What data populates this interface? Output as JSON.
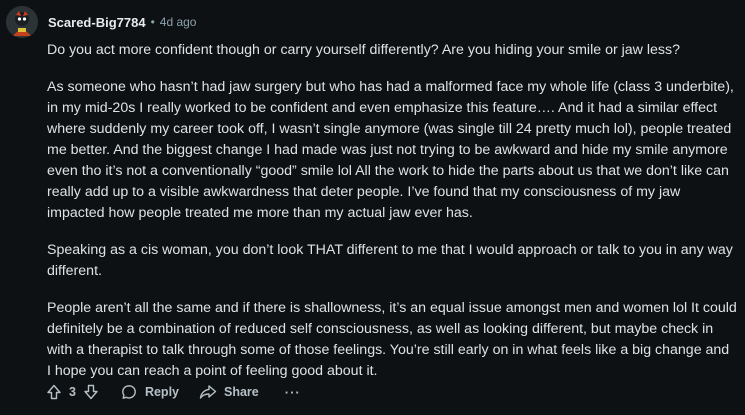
{
  "comment": {
    "author": "Scared-Big7784",
    "separator": "•",
    "timestamp": "4d ago",
    "paragraphs": [
      "Do you act more confident though or carry yourself differently? Are you hiding your smile or jaw less?",
      "As someone who hasn’t had jaw surgery but who has had a malformed face my whole life (class 3 underbite), in my mid-20s I really worked to be confident and even emphasize this feature…. And it had a similar effect where suddenly my career took off, I wasn’t single anymore (was single till 24 pretty much lol), people treated me better. And the biggest change I had made was just not trying to be awkward and hide my smile anymore even tho it’s not a conventionally “good” smile lol All the work to hide the parts about us that we don’t like can really add up to a visible awkwardness that deter people. I’ve found that my consciousness of my jaw impacted how people treated me more than my actual jaw ever has.",
      "Speaking as a cis woman, you don’t look THAT different to me that I would approach or talk to you in any way different.",
      "People aren’t all the same and if there is shallowness, it’s an equal issue amongst men and women lol It could definitely be a combination of reduced self consciousness, as well as looking different, but maybe check in with a therapist to talk through some of those feelings. You’re still early on in what feels like a big change and I hope you can reach a point of feeling good about it."
    ],
    "actions": {
      "upvote_icon": "upvote-arrow-icon",
      "vote_count": "3",
      "downvote_icon": "downvote-arrow-icon",
      "reply_label": "Reply",
      "reply_icon": "speech-bubble-icon",
      "share_label": "Share",
      "share_icon": "share-arrow-icon",
      "more_label": "···"
    }
  },
  "colors": {
    "background": "#0e1113",
    "text": "#dfe2e4",
    "meta": "#8ba2ad",
    "action": "#b5c0c6"
  }
}
